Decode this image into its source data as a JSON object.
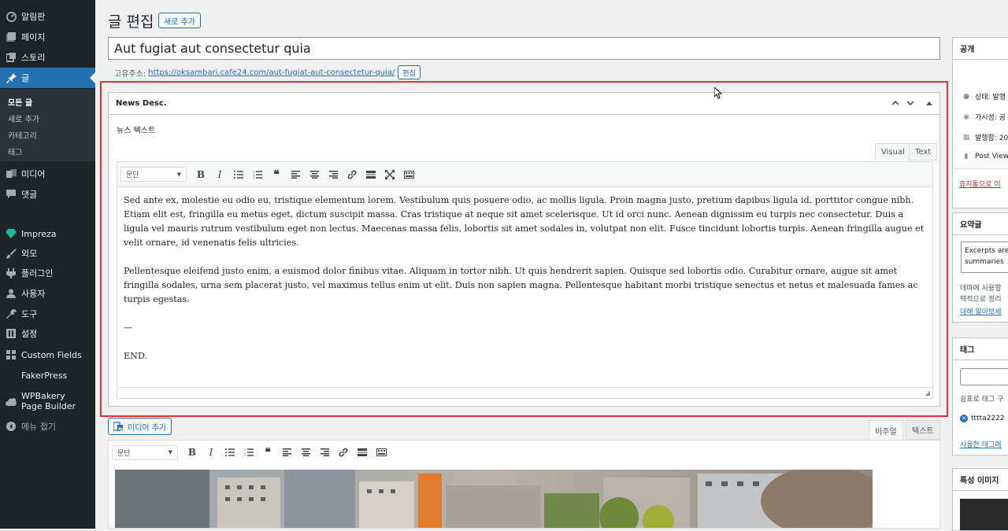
{
  "sidebar": {
    "items": [
      {
        "label": "알림판",
        "icon": "dashboard-icon"
      },
      {
        "label": "페이지",
        "icon": "pages-icon"
      },
      {
        "label": "스토리",
        "icon": "stories-icon"
      },
      {
        "label": "글",
        "icon": "pin-icon"
      },
      {
        "label": "미디어",
        "icon": "media-icon"
      },
      {
        "label": "댓글",
        "icon": "comment-icon"
      },
      {
        "label": "Impreza",
        "icon": "diamond-icon"
      },
      {
        "label": "외모",
        "icon": "brush-icon"
      },
      {
        "label": "플러그인",
        "icon": "plugin-icon"
      },
      {
        "label": "사용자",
        "icon": "user-icon"
      },
      {
        "label": "도구",
        "icon": "wrench-icon"
      },
      {
        "label": "설정",
        "icon": "settings-icon"
      },
      {
        "label": "Custom Fields",
        "icon": "grid-icon"
      },
      {
        "label": "FakerPress",
        "icon": ""
      },
      {
        "label": "WPBakery Page Builder",
        "icon": "cloud-icon"
      },
      {
        "label": "메뉴 접기",
        "icon": "collapse-icon"
      }
    ],
    "submenu": [
      "모든 글",
      "새로 추가",
      "카테고리",
      "태그"
    ]
  },
  "header": {
    "title": "글 편집",
    "add_new": "새로 추가"
  },
  "post": {
    "title": "Aut fugiat aut consectetur quia",
    "permalink_label": "고유주소:",
    "permalink_url": "https://oksambari.cafe24.com/aut-fugiat-aut-consectetur-quia/",
    "permalink_edit": "편집"
  },
  "metabox": {
    "title": "News Desc.",
    "field_label": "뉴스 텍스트",
    "tab_visual": "Visual",
    "tab_text": "Text",
    "format": "문단",
    "paragraphs": [
      "Sed ante ex, molestie eu odio eu, tristique elementum lorem. Vestibulum quis posuere odio, ac mollis ligula. Proin magna justo, pretium dapibus ligula id, porttitor congue nibh. Etiam elit est, fringilla eu metus eget, dictum suscipit massa. Cras tristique at neque sit amet scelerisque. Ut id orci nunc. Aenean dignissim eu turpis nec consectetur. Duis a ligula vel mauris rutrum vestibulum eget non lectus. Maecenas massa felis, lobortis sit amet sodales in, volutpat non elit. Fusce tincidunt lobortis turpis. Aenean fringilla augue et velit ornare, id venenatis felis ultricies.",
      "Pellentesque eleifend justo enim, a euismod dolor finibus vitae. Aliquam in tortor nibh. Ut quis hendrerit sapien. Quisque sed lobortis odio. Curabitur ornare, augue sit amet fringilla sodales, urna sem placerat justo, vel maximus tellus enim ut elit. Duis non sapien magna. Pellentesque habitant morbi tristique senectus et netus et malesuada fames ac turpis egestas.",
      "—",
      "END."
    ]
  },
  "main_editor": {
    "add_media": "미디어 추가",
    "tab_visual": "비주얼",
    "tab_text": "텍스트",
    "format": "문단"
  },
  "right": {
    "publish_title": "공개",
    "status": "상태: 발행",
    "visibility": "가시성: 공",
    "published": "발행함: 20",
    "post_views": "Post Views",
    "trash": "휴지통으로 이",
    "excerpt_title": "요약글",
    "excerpt_text": "Excerpts are summaries",
    "excerpt_help1": "테마에 사용할",
    "excerpt_help2": "택적으로 정리",
    "excerpt_link": "대해 알아보세",
    "tags_title": "태그",
    "tags_help": "쉼표로 태그 구",
    "tag_item": "tttta2222",
    "tags_link": "사용한 태그에",
    "featured_title": "특성 이미지"
  }
}
